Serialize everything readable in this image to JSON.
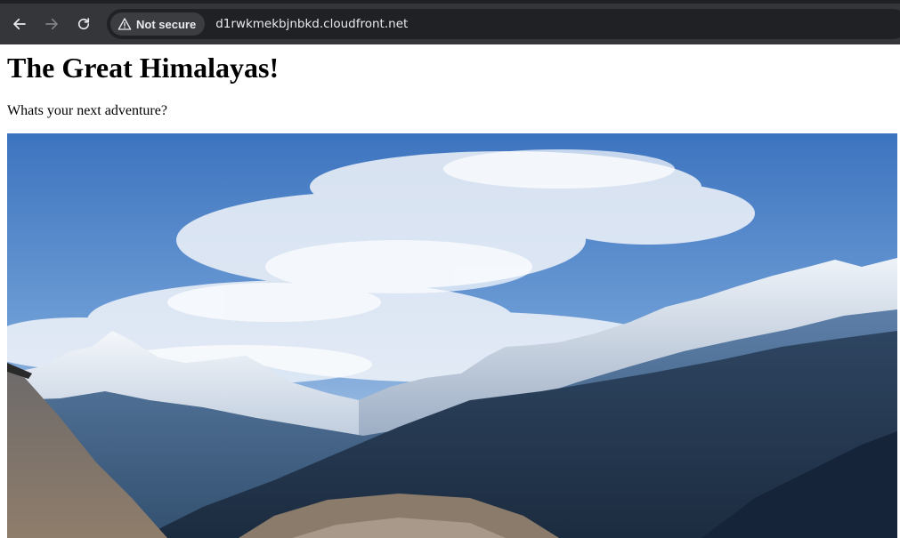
{
  "browser": {
    "security_label": "Not secure",
    "url": "d1rwkmekbjnbkd.cloudfront.net",
    "icons": {
      "back": "arrow-left",
      "forward": "arrow-right",
      "reload": "reload",
      "security": "warning-triangle"
    }
  },
  "page": {
    "title": "The Great Himalayas!",
    "subtitle": "Whats your next adventure?"
  },
  "colors": {
    "toolbar": "#35363a",
    "omnibox": "#202124",
    "chip": "#3c3d41",
    "toolbar_text": "#e8eaed"
  }
}
